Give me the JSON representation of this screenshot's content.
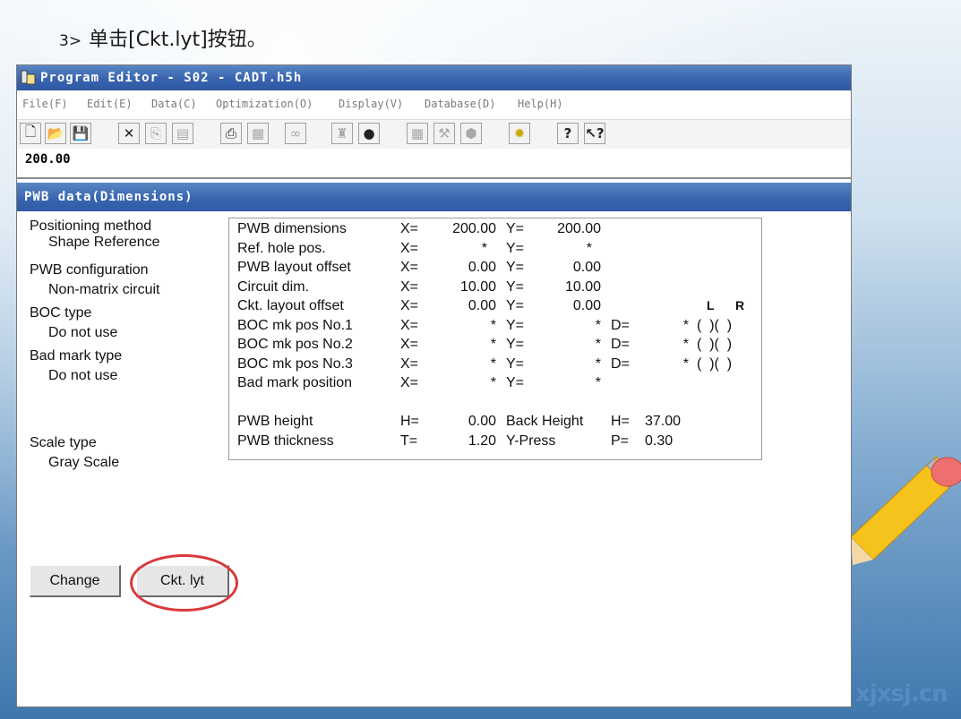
{
  "slide": {
    "step_num": "3>",
    "caption": "单击[Ckt.lyt]按钮。",
    "watermark": "xjxsj.cn"
  },
  "window": {
    "title": "Program Editor - S02 - CADT.h5h",
    "menu": [
      "File(F)",
      "Edit(E)",
      "Data(C)",
      "Optimization(O)",
      "Display(V)",
      "Database(D)",
      "Help(H)"
    ],
    "toolbar_icons": [
      "new-file-icon",
      "open-folder-icon",
      "save-icon",
      "cut-icon",
      "copy-icon",
      "paste-icon",
      "print-icon",
      "print-preview-icon",
      "link-icon",
      "tree-icon",
      "shapes-icon",
      "grid-icon",
      "tool-icon",
      "pack-icon",
      "lightbulb-icon",
      "help-icon",
      "context-help-icon"
    ],
    "value_field": "200.00"
  },
  "panel": {
    "title": "PWB data(Dimensions)",
    "left": {
      "positioning_label": "Positioning method",
      "positioning_value": "Shape Reference",
      "config_label": "PWB configuration",
      "config_value": "Non-matrix circuit",
      "boc_label": "BOC type",
      "boc_value": "Do not use",
      "badmark_label": "Bad mark type",
      "badmark_value": "Do not use",
      "scale_label": "Scale type",
      "scale_value": "Gray Scale"
    },
    "lr_header": {
      "l": "L",
      "r": "R"
    },
    "rows": [
      {
        "label": "PWB dimensions",
        "xk": "X=",
        "xv": "200.00",
        "yk": "Y=",
        "yv": "200.00"
      },
      {
        "label": "Ref. hole pos.",
        "xk": "X=",
        "xv": "*",
        "yk": "Y=",
        "yv": "*"
      },
      {
        "label": "PWB layout offset",
        "xk": "X=",
        "xv": "0.00",
        "yk": "Y=",
        "yv": "0.00"
      },
      {
        "label": "Circuit dim.",
        "xk": "X=",
        "xv": "10.00",
        "yk": "Y=",
        "yv": "10.00"
      },
      {
        "label": "Ckt. layout offset",
        "xk": "X=",
        "xv": "0.00",
        "yk": "Y=",
        "yv": "0.00"
      },
      {
        "label": "BOC mk pos No.1",
        "xk": "X=",
        "xv": "*",
        "yk": "Y=",
        "yv": "*",
        "dk": "D=",
        "dv": "*",
        "lr": "(  )(  )"
      },
      {
        "label": "BOC mk pos No.2",
        "xk": "X=",
        "xv": "*",
        "yk": "Y=",
        "yv": "*",
        "dk": "D=",
        "dv": "*",
        "lr": "(  )(  )"
      },
      {
        "label": "BOC mk pos No.3",
        "xk": "X=",
        "xv": "*",
        "yk": "Y=",
        "yv": "*",
        "dk": "D=",
        "dv": "*",
        "lr": "(  )(  )"
      },
      {
        "label": "Bad mark position",
        "xk": "X=",
        "xv": "*",
        "yk": "Y=",
        "yv": "*"
      }
    ],
    "height_row": {
      "label": "PWB height",
      "k": "H=",
      "v": "0.00",
      "label2": "Back Height",
      "k2": "H=",
      "v2": "37.00"
    },
    "thick_row": {
      "label": "PWB thickness",
      "k": "T=",
      "v": "1.20",
      "label2": "Y-Press",
      "k2": "P=",
      "v2": "0.30"
    },
    "buttons": {
      "change": "Change",
      "ckt_lyt": "Ckt. lyt"
    }
  }
}
